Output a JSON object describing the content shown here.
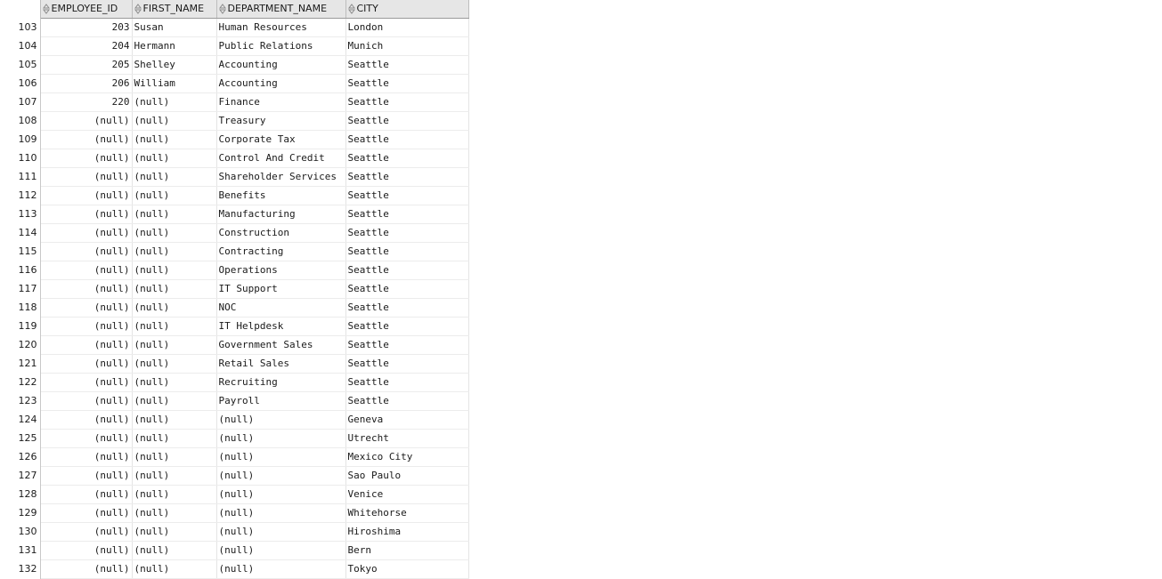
{
  "columns": [
    "EMPLOYEE_ID",
    "FIRST_NAME",
    "DEPARTMENT_NAME",
    "CITY"
  ],
  "rows": [
    {
      "n": "103",
      "id": "203",
      "first": "Susan",
      "dept": "Human Resources",
      "city": "London"
    },
    {
      "n": "104",
      "id": "204",
      "first": "Hermann",
      "dept": "Public Relations",
      "city": "Munich"
    },
    {
      "n": "105",
      "id": "205",
      "first": "Shelley",
      "dept": "Accounting",
      "city": "Seattle"
    },
    {
      "n": "106",
      "id": "206",
      "first": "William",
      "dept": "Accounting",
      "city": "Seattle"
    },
    {
      "n": "107",
      "id": "220",
      "first": "(null)",
      "dept": "Finance",
      "city": "Seattle"
    },
    {
      "n": "108",
      "id": "(null)",
      "first": "(null)",
      "dept": "Treasury",
      "city": "Seattle"
    },
    {
      "n": "109",
      "id": "(null)",
      "first": "(null)",
      "dept": "Corporate Tax",
      "city": "Seattle"
    },
    {
      "n": "110",
      "id": "(null)",
      "first": "(null)",
      "dept": "Control And Credit",
      "city": "Seattle"
    },
    {
      "n": "111",
      "id": "(null)",
      "first": "(null)",
      "dept": "Shareholder Services",
      "city": "Seattle"
    },
    {
      "n": "112",
      "id": "(null)",
      "first": "(null)",
      "dept": "Benefits",
      "city": "Seattle"
    },
    {
      "n": "113",
      "id": "(null)",
      "first": "(null)",
      "dept": "Manufacturing",
      "city": "Seattle"
    },
    {
      "n": "114",
      "id": "(null)",
      "first": "(null)",
      "dept": "Construction",
      "city": "Seattle"
    },
    {
      "n": "115",
      "id": "(null)",
      "first": "(null)",
      "dept": "Contracting",
      "city": "Seattle"
    },
    {
      "n": "116",
      "id": "(null)",
      "first": "(null)",
      "dept": "Operations",
      "city": "Seattle"
    },
    {
      "n": "117",
      "id": "(null)",
      "first": "(null)",
      "dept": "IT Support",
      "city": "Seattle"
    },
    {
      "n": "118",
      "id": "(null)",
      "first": "(null)",
      "dept": "NOC",
      "city": "Seattle"
    },
    {
      "n": "119",
      "id": "(null)",
      "first": "(null)",
      "dept": "IT Helpdesk",
      "city": "Seattle"
    },
    {
      "n": "120",
      "id": "(null)",
      "first": "(null)",
      "dept": "Government Sales",
      "city": "Seattle"
    },
    {
      "n": "121",
      "id": "(null)",
      "first": "(null)",
      "dept": "Retail Sales",
      "city": "Seattle"
    },
    {
      "n": "122",
      "id": "(null)",
      "first": "(null)",
      "dept": "Recruiting",
      "city": "Seattle"
    },
    {
      "n": "123",
      "id": "(null)",
      "first": "(null)",
      "dept": "Payroll",
      "city": "Seattle"
    },
    {
      "n": "124",
      "id": "(null)",
      "first": "(null)",
      "dept": "(null)",
      "city": "Geneva"
    },
    {
      "n": "125",
      "id": "(null)",
      "first": "(null)",
      "dept": "(null)",
      "city": "Utrecht"
    },
    {
      "n": "126",
      "id": "(null)",
      "first": "(null)",
      "dept": "(null)",
      "city": "Mexico City"
    },
    {
      "n": "127",
      "id": "(null)",
      "first": "(null)",
      "dept": "(null)",
      "city": "Sao Paulo"
    },
    {
      "n": "128",
      "id": "(null)",
      "first": "(null)",
      "dept": "(null)",
      "city": "Venice"
    },
    {
      "n": "129",
      "id": "(null)",
      "first": "(null)",
      "dept": "(null)",
      "city": "Whitehorse"
    },
    {
      "n": "130",
      "id": "(null)",
      "first": "(null)",
      "dept": "(null)",
      "city": "Hiroshima"
    },
    {
      "n": "131",
      "id": "(null)",
      "first": "(null)",
      "dept": "(null)",
      "city": "Bern"
    },
    {
      "n": "132",
      "id": "(null)",
      "first": "(null)",
      "dept": "(null)",
      "city": "Tokyo"
    }
  ],
  "icons": {
    "sort": "sort-arrows-icon"
  }
}
